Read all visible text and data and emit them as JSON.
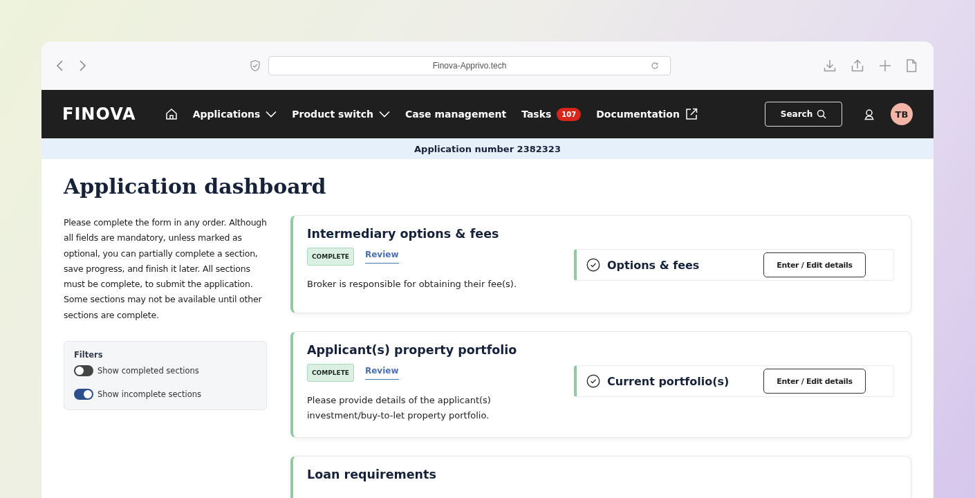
{
  "browser": {
    "url": "Finova-Apprivo.tech"
  },
  "nav": {
    "logo": "FINOVA",
    "items": [
      {
        "label": "Applications",
        "kind": "dropdown"
      },
      {
        "label": "Product switch",
        "kind": "dropdown"
      },
      {
        "label": "Case management",
        "kind": "plain"
      },
      {
        "label": "Tasks",
        "kind": "badge",
        "badge": "107"
      },
      {
        "label": "Documentation",
        "kind": "external"
      }
    ],
    "search": "Search",
    "avatar": "TB"
  },
  "banner": "Application number 2382323",
  "title": "Application dashboard",
  "intro": "Please complete the form in any order. Although all fields are mandatory, unless marked as optional, you can partially complete a section, save progress, and finish it later. All sections must be complete, to submit the application. Some sections may not be available until other sections are complete.",
  "filters": {
    "title": "Filters",
    "toggles": [
      {
        "label": "Show completed sections",
        "on": false
      },
      {
        "label": "Show incomplete sections",
        "on": true
      }
    ]
  },
  "sections": [
    {
      "title": "Intermediary options & fees",
      "status": "COMPLETE",
      "link": "Review",
      "description": "Broker is responsible for obtaining their fee(s).",
      "task": {
        "label": "Options & fees",
        "done": true,
        "button": "Enter / Edit details"
      }
    },
    {
      "title": "Applicant(s) property portfolio",
      "status": "COMPLETE",
      "link": "Review",
      "description": "Please provide details of the applicant(s) investment/buy-to-let property portfolio.",
      "task": {
        "label": "Current portfolio(s)",
        "done": true,
        "button": "Enter / Edit details"
      }
    },
    {
      "title": "Loan requirements"
    }
  ]
}
